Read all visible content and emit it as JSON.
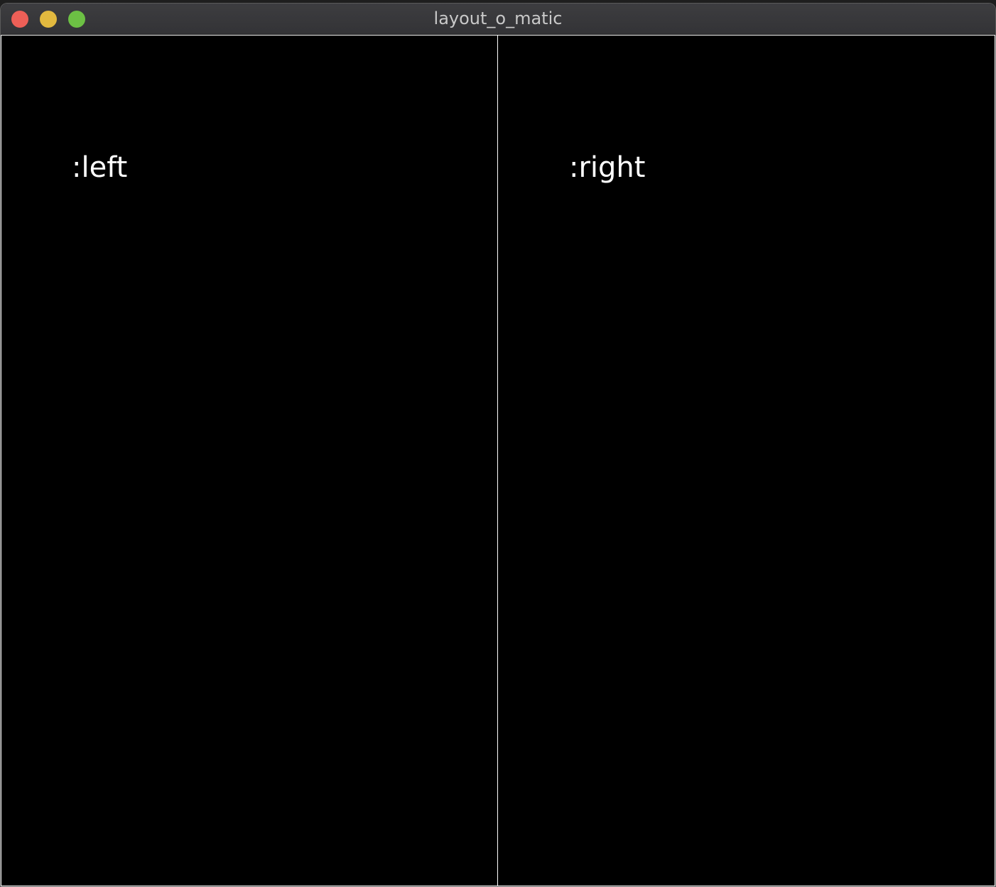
{
  "window": {
    "title": "layout_o_matic"
  },
  "colors": {
    "close": "#ed5f57",
    "minimize": "#e2b93f",
    "zoom": "#6cc044",
    "pane_background": "#000000",
    "pane_border": "#ffffff"
  },
  "panes": {
    "left": {
      "label": ":left"
    },
    "right": {
      "label": ":right"
    }
  }
}
